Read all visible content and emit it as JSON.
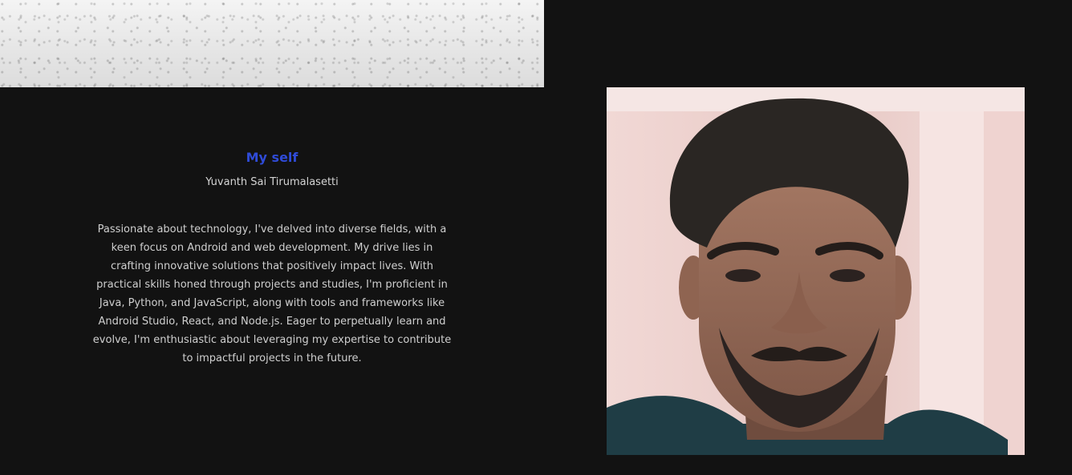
{
  "about": {
    "title": "My self",
    "name": "Yuvanth Sai Tirumalasetti",
    "bio": "Passionate about technology, I've delved into diverse fields, with a keen focus on Android and web development. My drive lies in crafting innovative solutions that positively impact lives. With practical skills honed through projects and studies, I'm proficient in Java, Python, and JavaScript, along with tools and frameworks like Android Studio, React, and Node.js. Eager to perpetually learn and evolve, I'm enthusiastic about leveraging my expertise to contribute to impactful projects in the future."
  },
  "colors": {
    "background": "#121212",
    "accent": "#2f4bd8",
    "text": "#cfcfcf"
  }
}
